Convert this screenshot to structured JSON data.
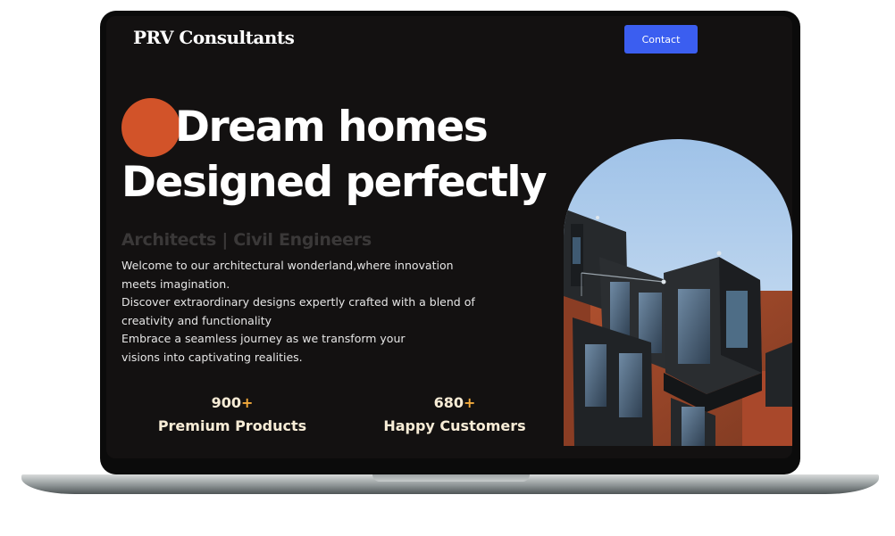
{
  "header": {
    "brand": "PRV Consultants",
    "contact_label": "Contact"
  },
  "hero": {
    "title_line1": "Dream homes",
    "title_line2": "Designed perfectly",
    "subtitle": "Architects | Civil Engineers",
    "description": [
      "Welcome to our architectural wonderland,where innovation",
      "meets imagination.",
      "Discover extraordinary designs expertly crafted with a blend of",
      "creativity and functionality",
      "Embrace a seamless journey as we transform your",
      "visions into captivating realities."
    ]
  },
  "stats": [
    {
      "number": "900",
      "suffix": "+",
      "label": "Premium Products"
    },
    {
      "number": "680",
      "suffix": "+",
      "label": "Happy Customers"
    }
  ],
  "colors": {
    "accent_orange": "#d25329",
    "button_blue": "#3b5ef0",
    "background": "#131111",
    "stat_plus": "#f2a93b"
  }
}
